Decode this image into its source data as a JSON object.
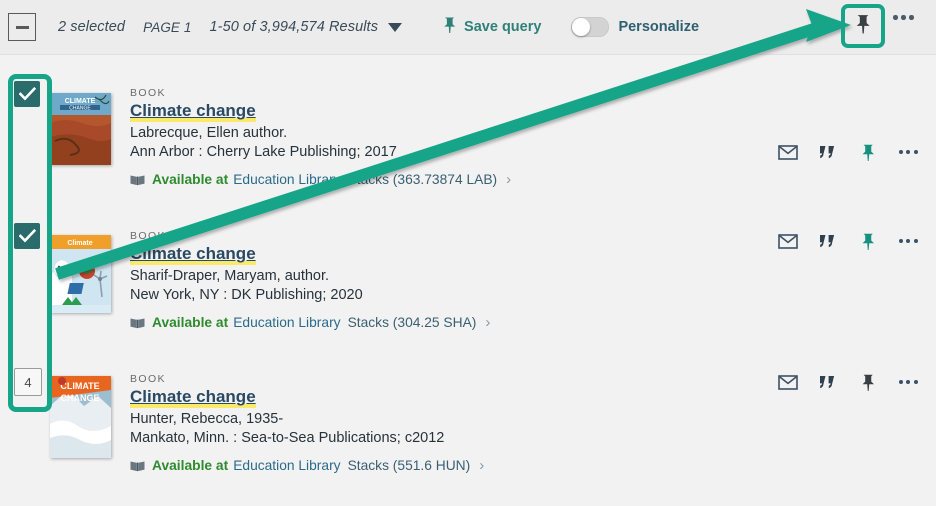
{
  "toolbar": {
    "deselect_icon": "minus-square-icon",
    "selected_count": "2 selected",
    "page_label": "PAGE 1",
    "results_label": "1-50 of 3,994,574 Results",
    "caret_icon": "chevron-down-icon",
    "save_query_label": "Save query",
    "save_query_icon": "pin-icon",
    "personalize_label": "Personalize",
    "personalize_toggle_state": "off",
    "pin_icon": "pin-icon",
    "more_icon": "ellipsis-icon"
  },
  "annotations": {
    "highlight_color": "#17a589",
    "pin_button_highlighted": true,
    "checkbox_column_highlighted": true,
    "arrow": "arrow-pointing-to-pin-button"
  },
  "results": [
    {
      "selected": true,
      "checkbox_icon": "checkmark-icon",
      "type": "BOOK",
      "title": "Climate change",
      "author": "Labrecque, Ellen author.",
      "publication": "Ann Arbor : Cherry Lake Publishing; 2017",
      "availability_status": "Available at",
      "library": "Education Library",
      "location": "Stacks (363.73874 LAB)",
      "chevron": "›",
      "actions": [
        "email-icon",
        "citation-icon",
        "pin-icon",
        "ellipsis-icon"
      ],
      "pinned": true,
      "cover_alt": "Climate change cover with dry cracked earth"
    },
    {
      "selected": true,
      "checkbox_icon": "checkmark-icon",
      "type": "BOOK",
      "title": "Climate change",
      "author": "Sharif-Draper, Maryam, author.",
      "publication": "New York, NY : DK Publishing; 2020",
      "availability_status": "Available at",
      "library": "Education Library",
      "location": "Stacks (304.25 SHA)",
      "chevron": "›",
      "actions": [
        "email-icon",
        "citation-icon",
        "pin-icon",
        "ellipsis-icon"
      ],
      "pinned": true,
      "cover_alt": "Climate change cover with polar bear"
    },
    {
      "selected": false,
      "checkbox_number": "4",
      "type": "BOOK",
      "title": "Climate change",
      "author": "Hunter, Rebecca, 1935-",
      "publication": "Mankato, Minn. : Sea-to-Sea Publications; c2012",
      "availability_status": "Available at",
      "library": "Education Library",
      "location": "Stacks (551.6 HUN)",
      "chevron": "›",
      "actions": [
        "email-icon",
        "citation-icon",
        "pin-icon",
        "ellipsis-icon"
      ],
      "pinned": false,
      "cover_alt": "Climate change cover with glacier"
    }
  ],
  "colors": {
    "accent_teal": "#17a589",
    "link_blue": "#2a4a63",
    "available_green": "#2e8b2e",
    "highlight_yellow": "#fbe96a",
    "checkbox_teal": "#2a6b6b"
  }
}
